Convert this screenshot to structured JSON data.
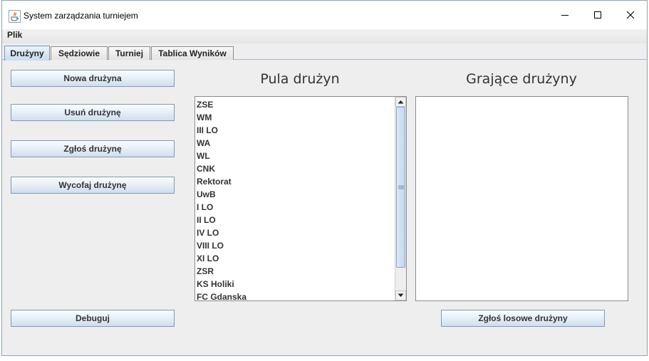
{
  "window": {
    "title": "System zarządzania turniejem"
  },
  "menu": {
    "items": [
      {
        "label": "Plik"
      }
    ]
  },
  "tabs": [
    {
      "label": "Drużyny",
      "active": true
    },
    {
      "label": "Sędziowie",
      "active": false
    },
    {
      "label": "Turniej",
      "active": false
    },
    {
      "label": "Tablica Wyników",
      "active": false
    }
  ],
  "buttons": {
    "new_team": "Nowa drużyna",
    "remove_team": "Usuń drużynę",
    "register_team": "Zgłoś drużynę",
    "withdraw_team": "Wycofaj drużynę",
    "debug": "Debuguj",
    "register_random": "Zgłoś losowe drużyny"
  },
  "pool": {
    "heading": "Pula drużyn",
    "teams": [
      "ZSE",
      "WM",
      "III LO",
      "WA",
      "WL",
      "CNK",
      "Rektorat",
      "UwB",
      "I LO",
      "II LO",
      "IV LO",
      "VIII LO",
      "XI LO",
      "ZSR",
      "KS Holiki",
      "FC Gdanska"
    ]
  },
  "playing": {
    "heading": "Grające drużyny",
    "teams": []
  },
  "colors": {
    "window_bg": "#eeeeee",
    "button_border": "#8099b8",
    "tab_active": "#c9dcef",
    "scroll_thumb": "#c4d7ec"
  },
  "icons": [
    "java-app-icon",
    "minimize-icon",
    "maximize-icon",
    "close-icon",
    "scroll-up-icon",
    "scroll-down-icon",
    "grip-icon"
  ]
}
